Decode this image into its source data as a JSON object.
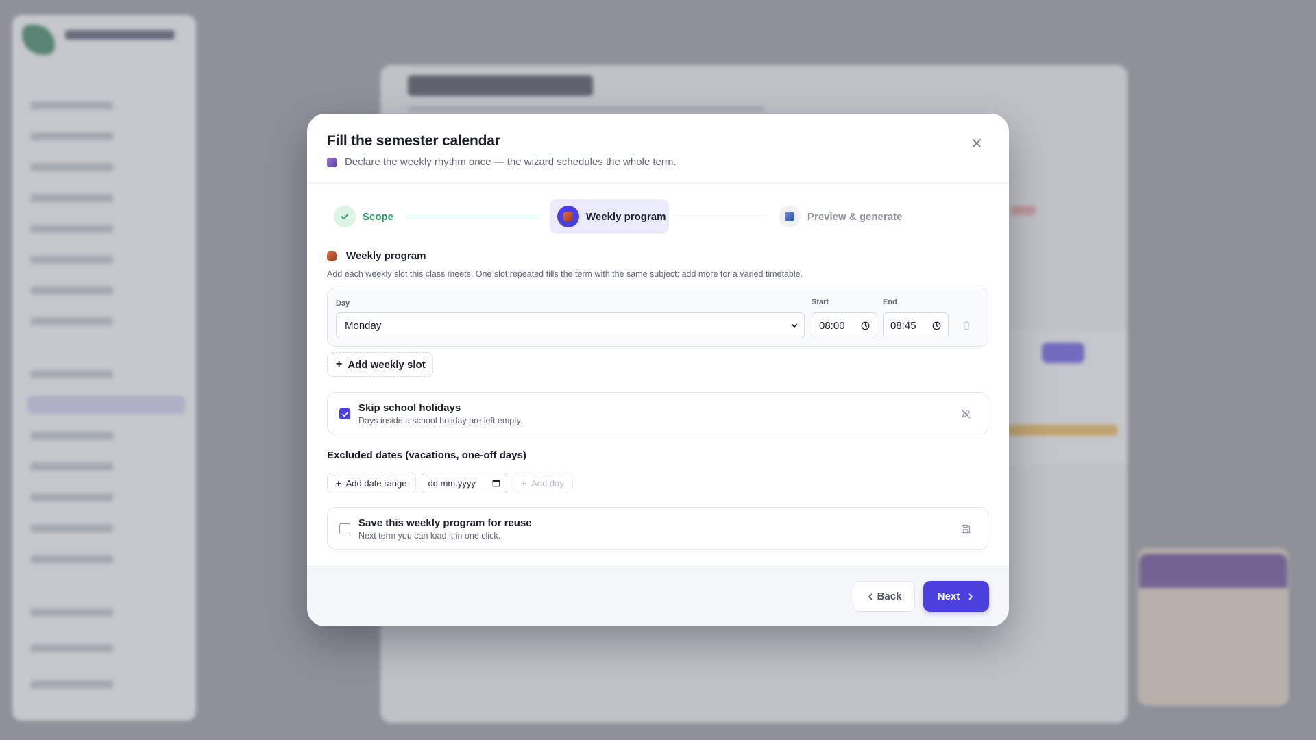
{
  "modal": {
    "title": "Fill the semester calendar",
    "subtitle": "Declare the weekly rhythm once — the wizard schedules the whole term.",
    "close_icon": "close-icon"
  },
  "stepper": {
    "steps": [
      {
        "label": "Scope",
        "state": "done",
        "icon": "check-icon"
      },
      {
        "label": "Weekly program",
        "state": "active",
        "icon": "calendar-emoji-icon"
      },
      {
        "label": "Preview & generate",
        "state": "upcoming",
        "icon": "calendar-emoji-icon"
      }
    ]
  },
  "weekly": {
    "title": "Weekly program",
    "help": "Add each weekly slot this class meets. One slot repeated fills the term with the same subject; add more for a varied timetable.",
    "slot": {
      "day_label": "Day",
      "day_value": "Monday",
      "start_label": "Start",
      "start_value": "08:00",
      "end_label": "End",
      "end_value": "08:45"
    },
    "add_slot_label": "Add weekly slot"
  },
  "holidays": {
    "title": "Skip school holidays",
    "description": "Days inside a school holiday are left empty.",
    "checked": true
  },
  "excluded": {
    "title": "Excluded dates (vacations, one-off days)",
    "add_range_label": "Add date range",
    "date_placeholder": "dd.mm.yyyy",
    "add_day_label": "Add day"
  },
  "save_program": {
    "title": "Save this weekly program for reuse",
    "description": "Next term you can load it in one click.",
    "checked": false
  },
  "footer": {
    "back_label": "Back",
    "next_label": "Next"
  },
  "colors": {
    "accent": "#4b3fe0",
    "success": "#1f9a5c",
    "muted_text": "#5f6675"
  }
}
